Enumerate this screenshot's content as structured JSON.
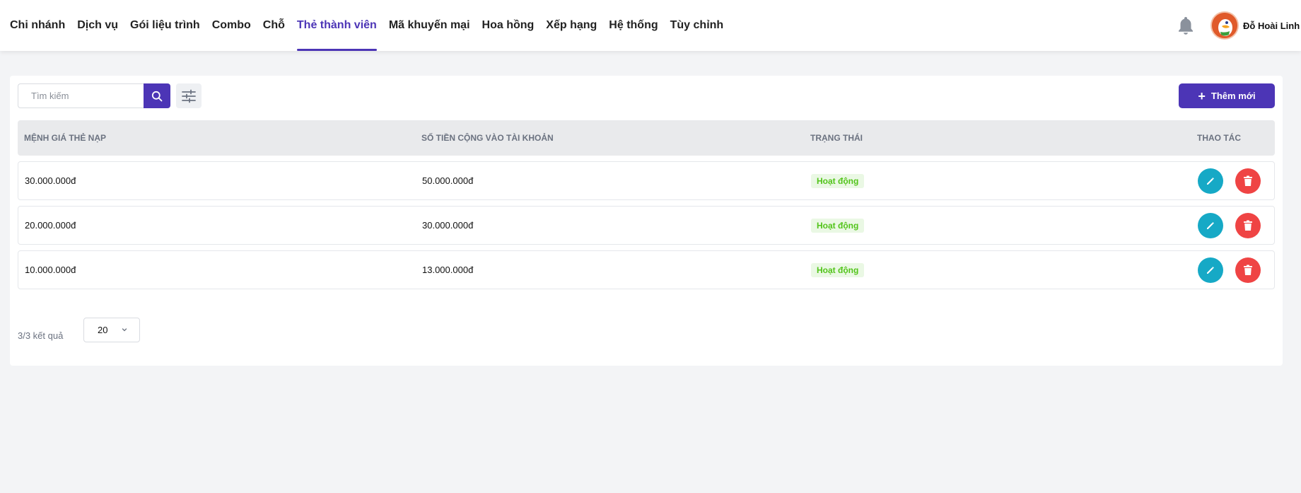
{
  "nav": {
    "items": [
      {
        "label": "Chi nhánh",
        "active": false
      },
      {
        "label": "Dịch vụ",
        "active": false
      },
      {
        "label": "Gói liệu trình",
        "active": false
      },
      {
        "label": "Combo",
        "active": false
      },
      {
        "label": "Chỗ",
        "active": false
      },
      {
        "label": "Thẻ thành viên",
        "active": true
      },
      {
        "label": "Mã khuyến mại",
        "active": false
      },
      {
        "label": "Hoa hồng",
        "active": false
      },
      {
        "label": "Xếp hạng",
        "active": false
      },
      {
        "label": "Hệ thống",
        "active": false
      },
      {
        "label": "Tùy chỉnh",
        "active": false
      }
    ]
  },
  "header": {
    "bell_icon": "bell-icon",
    "user_name": "Đỗ Hoài Linh",
    "avatar_icon": "duck-avatar"
  },
  "toolbar": {
    "search_placeholder": "Tìm kiếm",
    "search_value": "",
    "search_icon": "search-icon",
    "filter_icon": "sliders-icon",
    "add_label": "Thêm mới",
    "add_icon": "plus-icon"
  },
  "table": {
    "columns": [
      "MỆNH GIÁ THẺ NẠP",
      "SỐ TIỀN CỘNG VÀO TÀI KHOẢN",
      "TRẠNG THÁI",
      "THAO TÁC"
    ],
    "rows": [
      {
        "denomination": "30.000.000đ",
        "credit": "50.000.000đ",
        "status": "Hoạt động"
      },
      {
        "denomination": "20.000.000đ",
        "credit": "30.000.000đ",
        "status": "Hoạt động"
      },
      {
        "denomination": "10.000.000đ",
        "credit": "13.000.000đ",
        "status": "Hoạt động"
      }
    ]
  },
  "pagination": {
    "result_text": "3/3 kết quả",
    "page_size": "20"
  },
  "colors": {
    "primary": "#4c35b6",
    "edit": "#16a9c6",
    "delete": "#ef4444",
    "status_active": "#52c41a"
  }
}
